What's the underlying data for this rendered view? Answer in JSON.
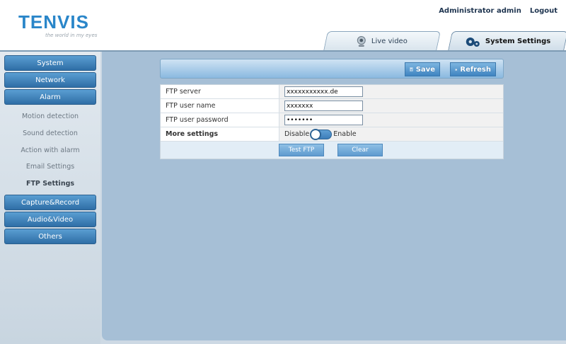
{
  "header": {
    "logo": "TENVIS",
    "tagline": "the world in my eyes",
    "user_label": "Administrator admin",
    "logout_label": "Logout"
  },
  "tabs": {
    "live": "Live video",
    "system": "System Settings"
  },
  "sidebar": {
    "items": [
      {
        "label": "System"
      },
      {
        "label": "Network"
      },
      {
        "label": "Alarm"
      }
    ],
    "sub_items": [
      {
        "label": "Motion detection"
      },
      {
        "label": "Sound detection"
      },
      {
        "label": "Action with alarm"
      },
      {
        "label": "Email Settings"
      },
      {
        "label": "FTP Settings"
      }
    ],
    "items_after": [
      {
        "label": "Capture&Record"
      },
      {
        "label": "Audio&Video"
      },
      {
        "label": "Others"
      }
    ]
  },
  "toolbar": {
    "save_label": "Save",
    "refresh_label": "Refresh"
  },
  "form": {
    "ftp_server_label": "FTP server",
    "ftp_server_value": "xxxxxxxxxxx.de",
    "ftp_user_label": "FTP user name",
    "ftp_user_value": "xxxxxxx",
    "ftp_password_label": "FTP user password",
    "ftp_password_value": "xxxxxxx",
    "more_settings_label": "More settings",
    "disable_label": "Disable",
    "enable_label": "Enable",
    "test_label": "Test FTP",
    "clear_label": "Clear"
  },
  "colors": {
    "accent": "#3f84c1",
    "sidebar_button": "#2f6ea6",
    "content_bg": "#a6bfd6"
  }
}
